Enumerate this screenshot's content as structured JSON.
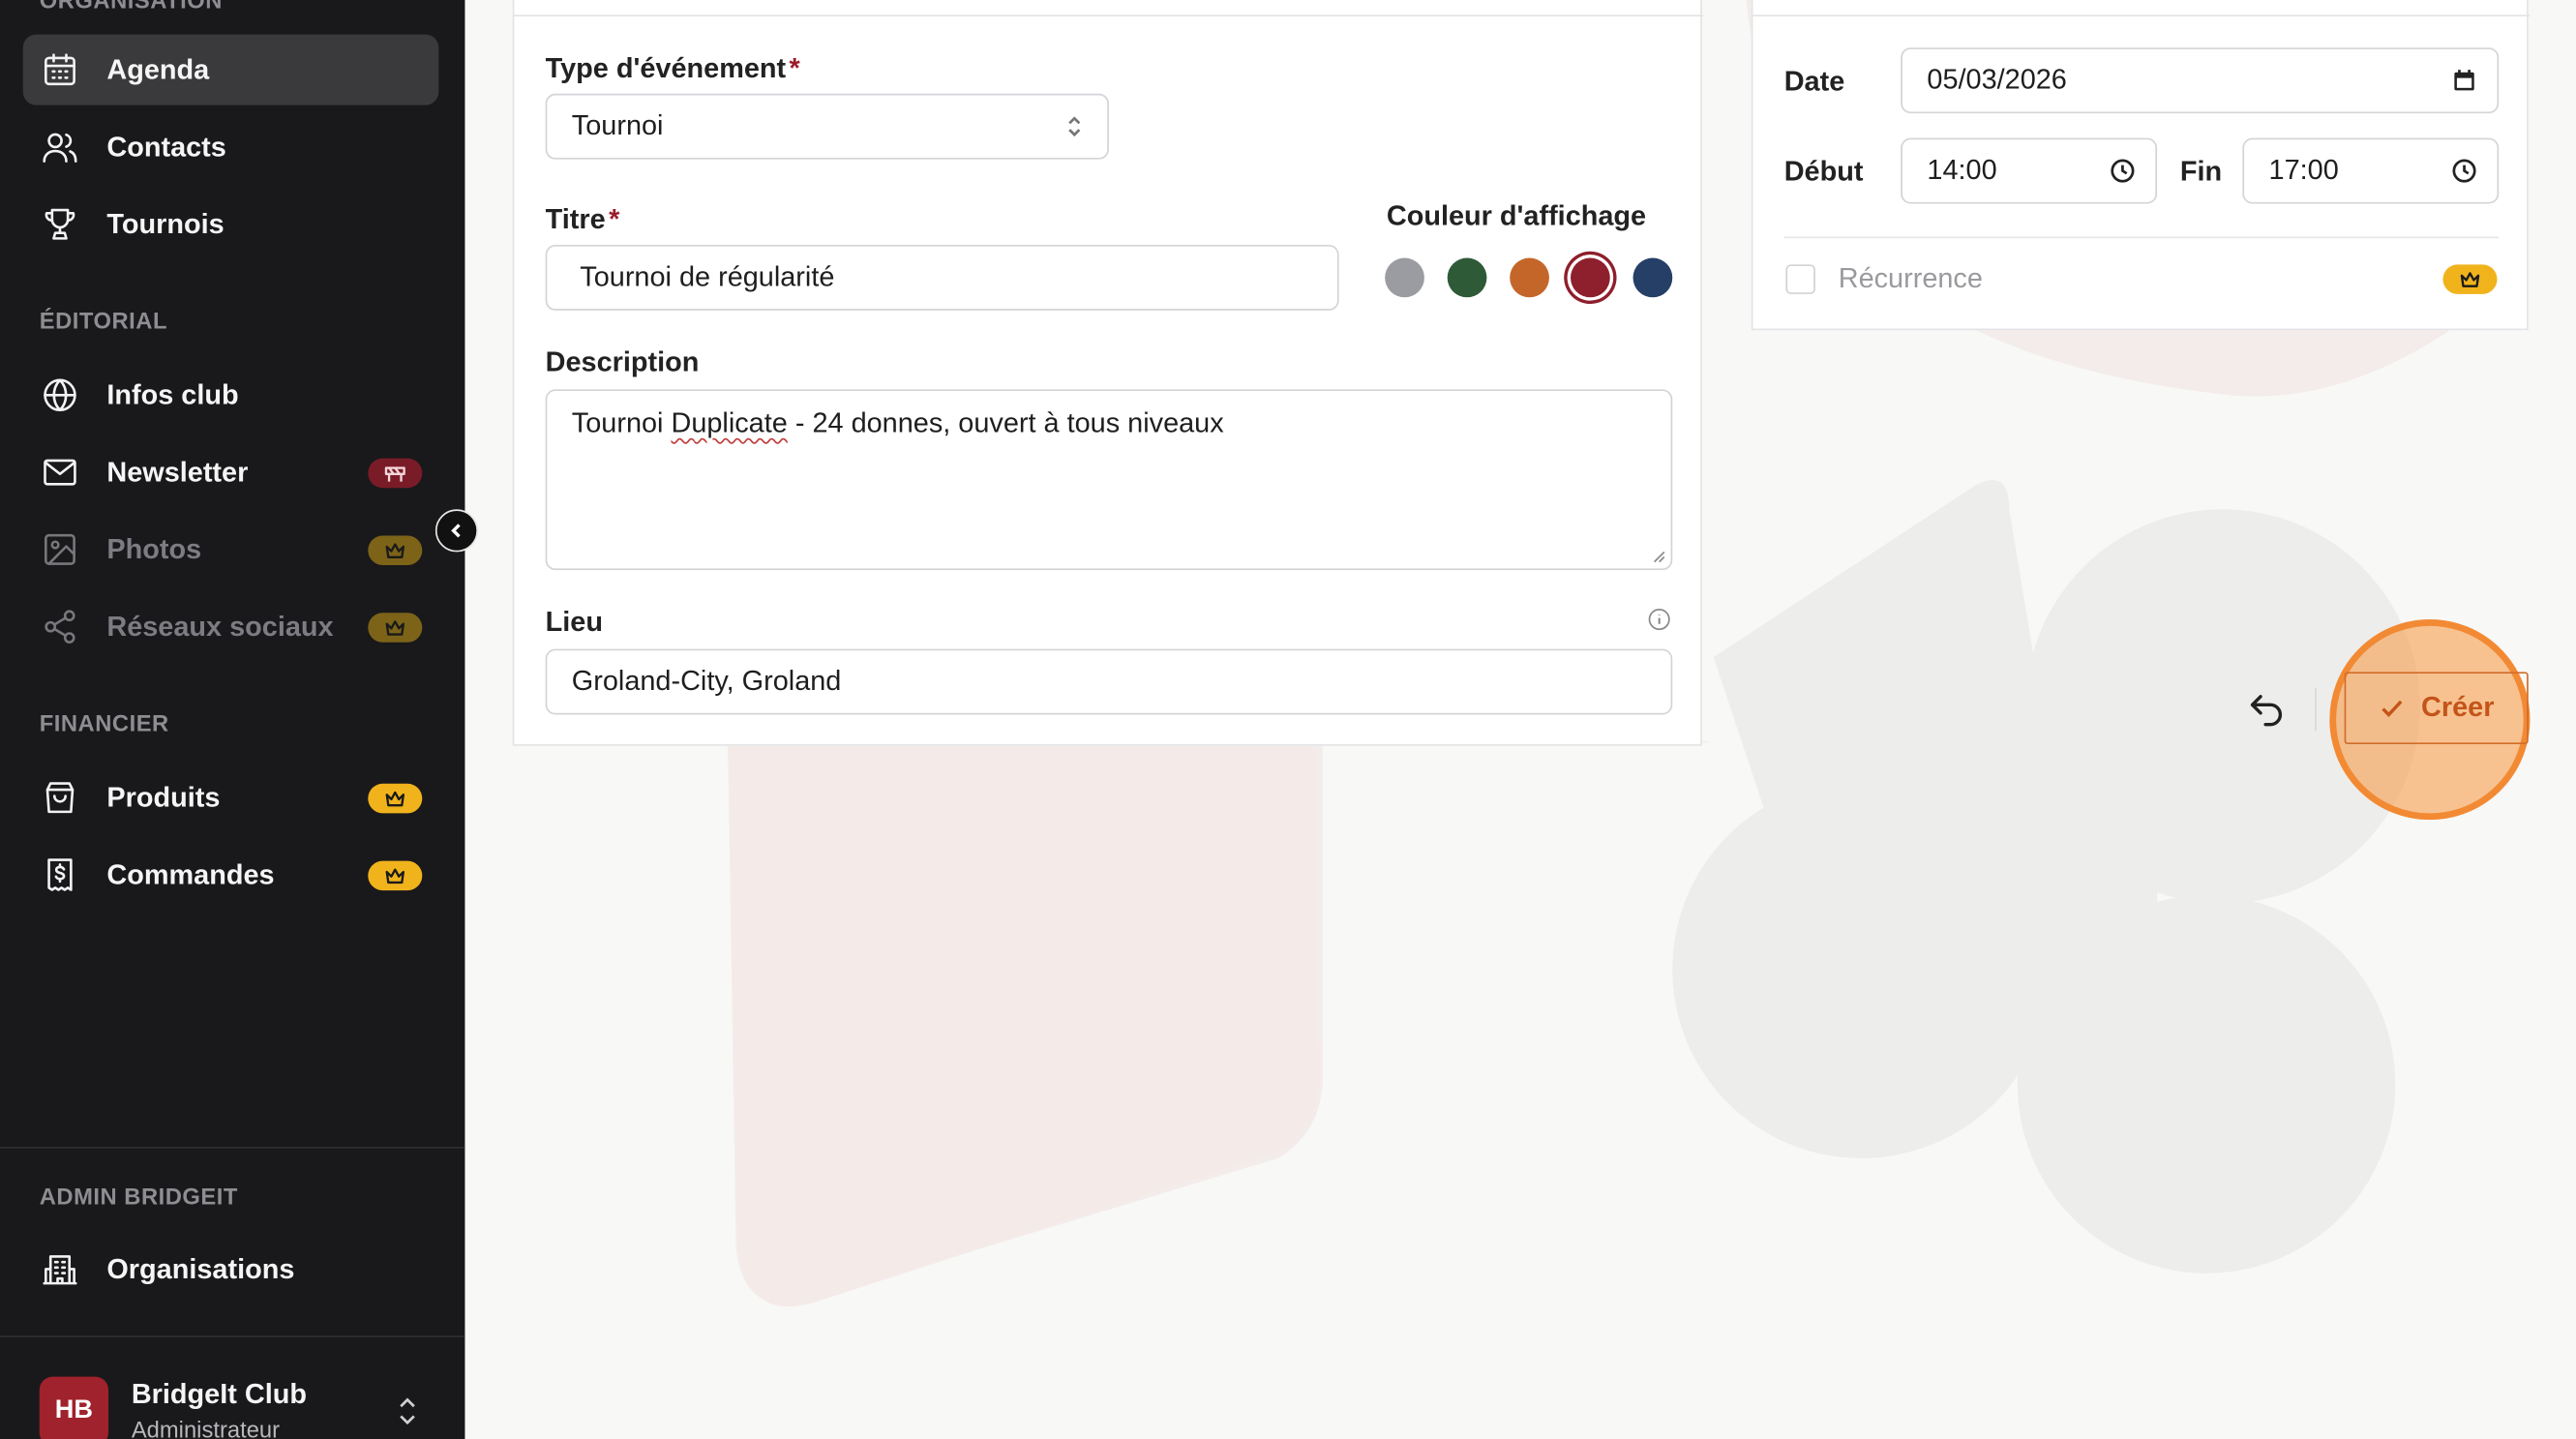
{
  "sidebar": {
    "sections": {
      "organisation": "ORGANISATION",
      "editorial": "ÉDITORIAL",
      "financier": "FINANCIER",
      "admin": "ADMIN BRIDGEIT"
    },
    "items": {
      "agenda": "Agenda",
      "contacts": "Contacts",
      "tournois": "Tournois",
      "infos_club": "Infos club",
      "newsletter": "Newsletter",
      "photos": "Photos",
      "reseaux_sociaux": "Réseaux sociaux",
      "produits": "Produits",
      "commandes": "Commandes",
      "organisations": "Organisations"
    },
    "user": {
      "initials": "HB",
      "name": "BridgeIt Club",
      "role": "Administrateur"
    }
  },
  "form": {
    "event_type": {
      "label": "Type d'événement",
      "required_mark": "*",
      "value": "Tournoi"
    },
    "title": {
      "label": "Titre",
      "required_mark": "*",
      "value": "Tournoi de régularité"
    },
    "display_color": {
      "label": "Couleur d'affichage",
      "options": [
        "#9b9ca1",
        "#2e5a38",
        "#c4662a",
        "#8e1f2c",
        "#263f66"
      ],
      "selected": "#8e1f2c"
    },
    "description": {
      "label": "Description",
      "value_pre": "Tournoi ",
      "value_misspelled": "Duplicate",
      "value_post": " - 24 donnes, ouvert à tous niveaux"
    },
    "location": {
      "label": "Lieu",
      "value": "Groland-City, Groland"
    }
  },
  "schedule": {
    "date_label": "Date",
    "date_value": "05/03/2026",
    "start_label": "Début",
    "start_value": "14:00",
    "end_label": "Fin",
    "end_value": "17:00",
    "recurrence_label": "Récurrence"
  },
  "actions": {
    "create_label": "Créer"
  },
  "colors": {
    "sidebar_bg": "#19191b",
    "accent_red": "#8e1f2c",
    "premium_gold": "#f0b31c",
    "create_orange": "#c4541a"
  }
}
